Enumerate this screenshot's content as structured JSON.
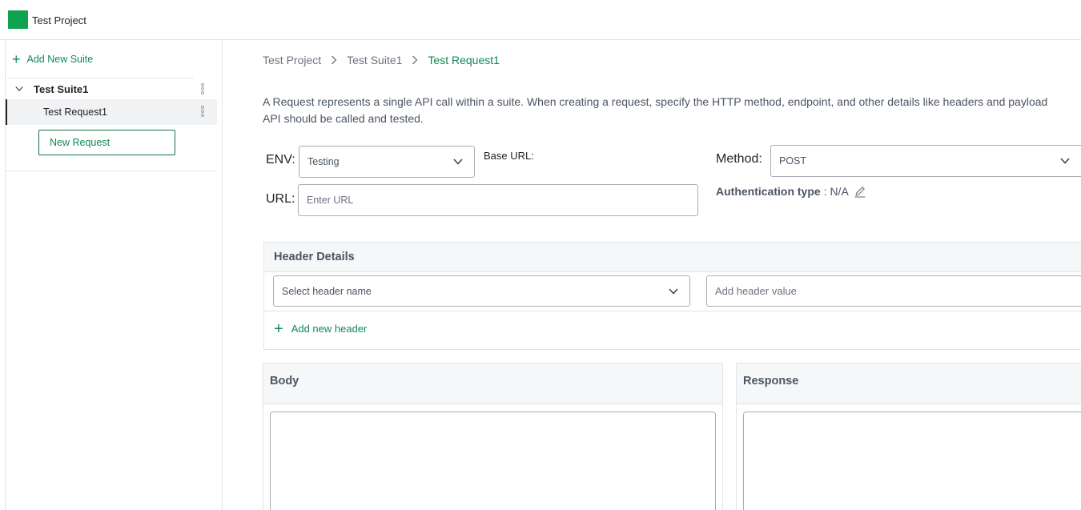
{
  "app": {
    "project_title": "Test Project",
    "brand_color": "#0fa34f"
  },
  "sidebar": {
    "add_suite_label": "Add New Suite",
    "suite": {
      "name": "Test Suite1",
      "requests": [
        {
          "name": "Test Request1"
        }
      ]
    },
    "new_request_label": "New Request"
  },
  "breadcrumb": [
    "Test Project",
    "Test Suite1",
    "Test Request1"
  ],
  "description": {
    "line1": "A Request represents a single API call within a suite. When creating a request, specify the HTTP method, endpoint, and other details like headers and payload",
    "line2": "API should be called and tested."
  },
  "form": {
    "env_label": "ENV:",
    "env_value": "Testing",
    "base_url_label": "Base URL:",
    "method_label": "Method:",
    "method_value": "POST",
    "url_label": "URL:",
    "url_placeholder": "Enter URL",
    "auth_label": "Authentication type",
    "auth_value": ": N/A"
  },
  "header_details": {
    "title": "Header Details",
    "name_placeholder": "Select header name",
    "value_placeholder": "Add header value",
    "add_label": "Add new header"
  },
  "body": {
    "title": "Body"
  },
  "response": {
    "title": "Response"
  },
  "icons": {
    "add": "plus-icon",
    "expand": "chevron-down-icon",
    "menu": "kebab-menu-icon",
    "breadcrumb_sep": "chevron-right-icon",
    "edit": "pencil-icon"
  }
}
